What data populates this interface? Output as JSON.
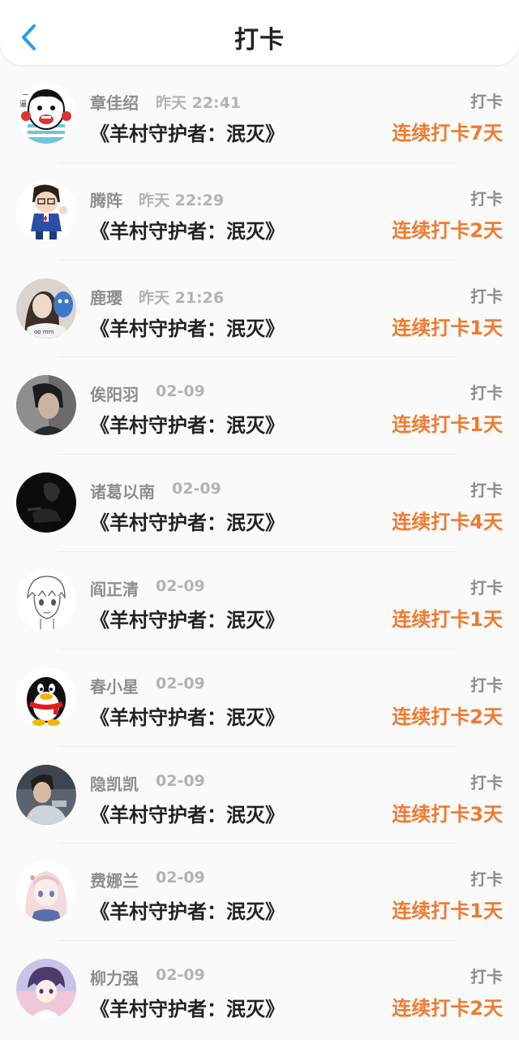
{
  "header": {
    "title": "打卡",
    "back_icon": "chevron-left-icon",
    "accent": "#2d9cf0"
  },
  "colors": {
    "streak": "#f07a2e",
    "name": "#8d8d8d",
    "time": "#b3b3b3"
  },
  "checkins": [
    {
      "name": "章佳绍",
      "time": "昨天 22:41",
      "book": "《羊村守护者：泯灭》",
      "tag": "打卡",
      "streak": "连续打卡7天",
      "avatar": "meme-face-avatar"
    },
    {
      "name": "腾阵",
      "time": "昨天 22:29",
      "book": "《羊村守护者：泯灭》",
      "tag": "打卡",
      "streak": "连续打卡2天",
      "avatar": "cartoon-boy-avatar"
    },
    {
      "name": "鹿璎",
      "time": "昨天 21:26",
      "book": "《羊村守护者：泯灭》",
      "tag": "打卡",
      "streak": "连续打卡1天",
      "avatar": "girl-photo-avatar"
    },
    {
      "name": "俟阳羽",
      "time": "02-09",
      "book": "《羊村守护者：泯灭》",
      "tag": "打卡",
      "streak": "连续打卡1天",
      "avatar": "boy-photo-avatar"
    },
    {
      "name": "诸葛以南",
      "time": "02-09",
      "book": "《羊村守护者：泯灭》",
      "tag": "打卡",
      "streak": "连续打卡4天",
      "avatar": "dark-photo-avatar"
    },
    {
      "name": "阎正清",
      "time": "02-09",
      "book": "《羊村守护者：泯灭》",
      "tag": "打卡",
      "streak": "连续打卡1天",
      "avatar": "sketch-anime-avatar"
    },
    {
      "name": "春小星",
      "time": "02-09",
      "book": "《羊村守护者：泯灭》",
      "tag": "打卡",
      "streak": "连续打卡2天",
      "avatar": "penguin-avatar"
    },
    {
      "name": "隐凯凯",
      "time": "02-09",
      "book": "《羊村守护者：泯灭》",
      "tag": "打卡",
      "streak": "连续打卡3天",
      "avatar": "man-photo-avatar"
    },
    {
      "name": "费娜兰",
      "time": "02-09",
      "book": "《羊村守护者：泯灭》",
      "tag": "打卡",
      "streak": "连续打卡1天",
      "avatar": "anime-girl-avatar"
    },
    {
      "name": "柳力强",
      "time": "02-09",
      "book": "《羊村守护者：泯灭》",
      "tag": "打卡",
      "streak": "连续打卡2天",
      "avatar": "anime-boy-avatar"
    }
  ]
}
